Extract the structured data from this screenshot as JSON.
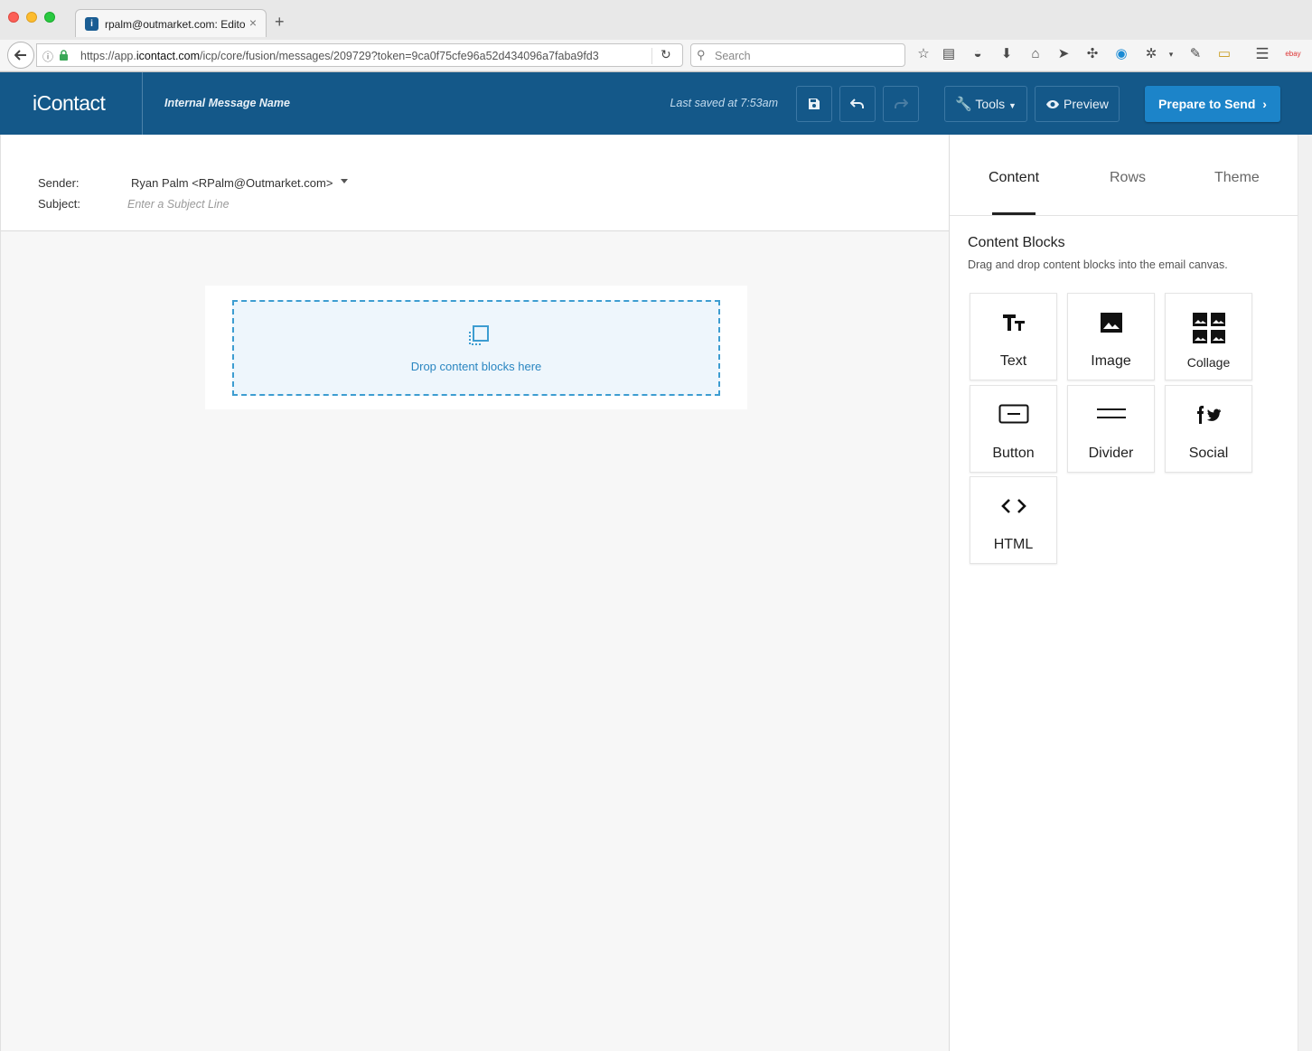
{
  "browser": {
    "tab_title": "rpalm@outmarket.com: Edito",
    "tab_close": "×",
    "new_tab": "+",
    "url_prefix": "https://app.",
    "url_domain": "icontact.com",
    "url_path": "/icp/core/fusion/messages/209729?token=9ca0f75cfe96a52d434096a7faba9fd3",
    "search_placeholder": "Search",
    "extension_text": "ebay"
  },
  "header": {
    "logo": "iContact",
    "message_name": "Internal Message Name",
    "last_saved": "Last saved at 7:53am",
    "tools_label": "Tools",
    "preview_label": "Preview",
    "send_label": "Prepare to Send"
  },
  "message": {
    "sender_label": "Sender:",
    "sender_value": "Ryan Palm <RPalm@Outmarket.com>",
    "subject_label": "Subject:",
    "subject_placeholder": "Enter a Subject Line"
  },
  "canvas": {
    "drop_text": "Drop content blocks here"
  },
  "panel": {
    "tabs": [
      "Content",
      "Rows",
      "Theme"
    ],
    "active_tab": "Content",
    "section_title": "Content Blocks",
    "section_desc": "Drag and drop content blocks into the email canvas.",
    "blocks": [
      {
        "label": "Text",
        "icon": "text-size-icon"
      },
      {
        "label": "Image",
        "icon": "image-icon"
      },
      {
        "label": "Collage",
        "icon": "collage-icon"
      },
      {
        "label": "Button",
        "icon": "button-icon"
      },
      {
        "label": "Divider",
        "icon": "divider-icon"
      },
      {
        "label": "Social",
        "icon": "social-icon"
      },
      {
        "label": "HTML",
        "icon": "code-icon"
      }
    ]
  },
  "colors": {
    "header_bg": "#145889",
    "send_button": "#1c84c9",
    "dropzone_border": "#3d9dd1",
    "dropzone_bg": "#eef6fc"
  }
}
